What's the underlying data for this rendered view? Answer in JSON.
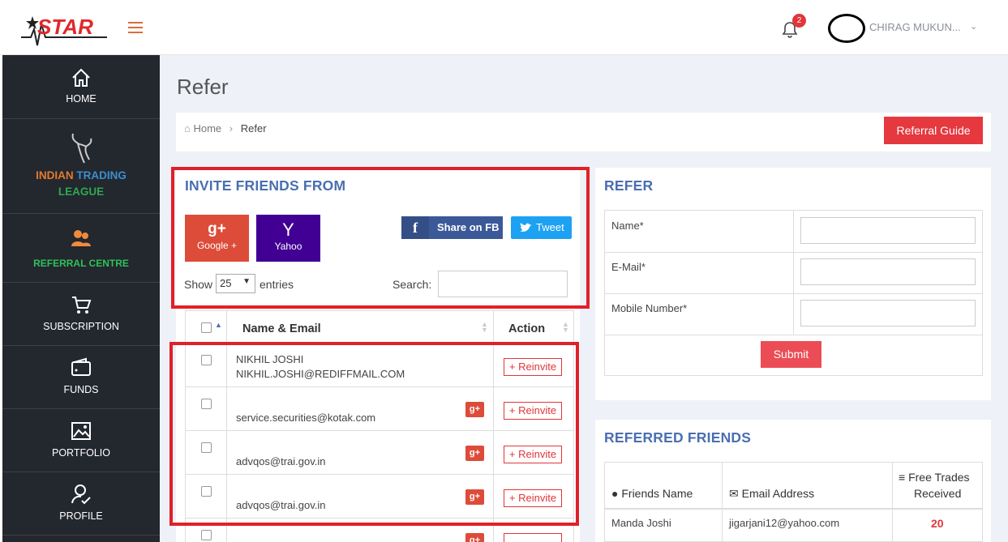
{
  "header": {
    "logo_text": "STAR",
    "notification_count": "2",
    "user_name": "CHIRAG MUKUN..."
  },
  "sidebar": {
    "items": [
      {
        "label": "HOME",
        "icon": "home-icon"
      },
      {
        "label_a": "INDIAN",
        "label_b": "TRADING",
        "label_c": "LEAGUE",
        "icon": "bull-icon"
      },
      {
        "label": "REFERRAL CENTRE",
        "icon": "users-icon"
      },
      {
        "label": "SUBSCRIPTION",
        "icon": "cart-icon"
      },
      {
        "label": "FUNDS",
        "icon": "wallet-icon"
      },
      {
        "label": "PORTFOLIO",
        "icon": "image-icon"
      },
      {
        "label": "PROFILE",
        "icon": "user-check-icon"
      }
    ]
  },
  "page": {
    "title": "Refer",
    "breadcrumb": {
      "home": "Home",
      "current": "Refer"
    },
    "referral_guide": "Referral Guide"
  },
  "invite": {
    "heading": "INVITE FRIENDS FROM",
    "google_label": "Google +",
    "google_glyph": "g+",
    "yahoo_label": "Yahoo",
    "yahoo_glyph": "Y",
    "fb_label": "Share on FB",
    "tweet_label": "Tweet",
    "show": "Show",
    "entries_value": "25",
    "entries": "entries",
    "search_label": "Search:",
    "col_name": "Name & Email",
    "col_action": "Action",
    "reinvite": "Reinvite",
    "rows": [
      {
        "name": "NIKHIL JOSHI",
        "email": "NIKHIL.JOSHI@REDIFFMAIL.COM"
      },
      {
        "name": "",
        "email": "service.securities@kotak.com"
      },
      {
        "name": "",
        "email": "advqos@trai.gov.in"
      },
      {
        "name": "",
        "email": "advqos@trai.gov.in"
      }
    ]
  },
  "refer": {
    "heading": "REFER",
    "name_label": "Name*",
    "email_label": "E-Mail*",
    "mobile_label": "Mobile Number*",
    "submit": "Submit"
  },
  "referred": {
    "heading": "REFERRED FRIENDS",
    "col_name": "Friends Name",
    "col_email": "Email Address",
    "col_trades_a": "Free Trades",
    "col_trades_b": "Received",
    "rows": [
      {
        "name": "Manda Joshi",
        "email": "jigarjani12@yahoo.com",
        "trades": "20"
      }
    ]
  },
  "colors": {
    "accent": "#e5383f",
    "heading_blue": "#4a6fb0",
    "sidebar": "#23272e"
  }
}
